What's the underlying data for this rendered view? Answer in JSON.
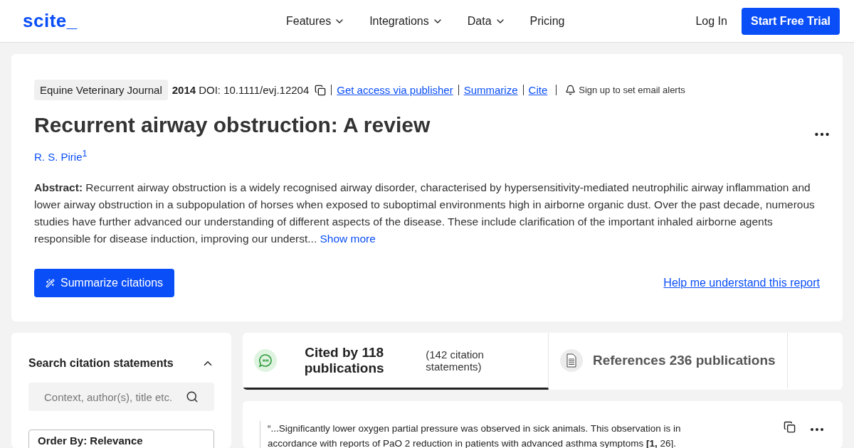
{
  "header": {
    "logo": "scite_",
    "nav": [
      {
        "label": "Features",
        "dropdown": true
      },
      {
        "label": "Integrations",
        "dropdown": true
      },
      {
        "label": "Data",
        "dropdown": true
      },
      {
        "label": "Pricing",
        "dropdown": false
      }
    ],
    "login": "Log In",
    "trial": "Start Free Trial"
  },
  "paper": {
    "journal": "Equine Veterinary Journal",
    "year": "2014",
    "doi": "DOI: 10.1111/evj.12204",
    "links": [
      "Get access via publisher",
      "Summarize",
      "Cite"
    ],
    "alert": "Sign up to set email alerts",
    "title": "Recurrent airway obstruction: A review",
    "author": "R. S. Pirie",
    "author_sup": "1",
    "abstract": "**Abstract:** Recurrent airway obstruction is a widely recognised airway disorder, characterised by hypersensitivity-mediated neutrophilic airway inflammation and lower airway obstruction in a subpopulation of horses when exposed to suboptimal environments high in airborne organic dust. Over the past decade, numerous studies have further advanced our understanding of different aspects of the disease. These include clarification of the important inhaled airborne agents responsible for disease induction, improving our underst...",
    "show_more": "Show more",
    "summarize_button": "Summarize citations",
    "help_link": "Help me understand this report"
  },
  "sidebar": {
    "title": "Search citation statements",
    "expanded": true,
    "search_placeholder": "Context, author(s), title etc.",
    "order": "Order By: Relevance"
  },
  "tabs": [
    {
      "kind": "cited",
      "title": "Cited by 118 publications",
      "subtitle": "(142 citation statements)",
      "selected": true
    },
    {
      "kind": "references",
      "title": "References 236 publications",
      "selected": false
    }
  ],
  "statement": {
    "text": "“...Significantly lower oxygen partial pressure was observed in sick animals. This observation is in accordance with reports of PaO 2 reduction in patients with advanced asthma symptoms **[1,** 26]."
  }
}
